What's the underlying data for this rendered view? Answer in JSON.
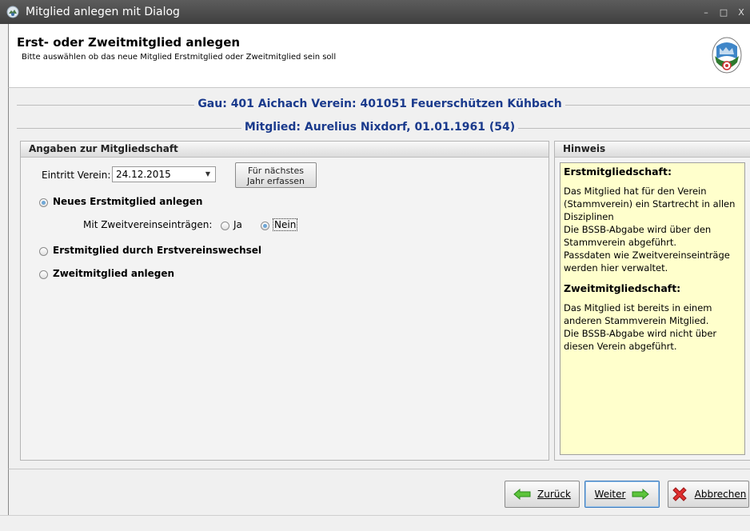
{
  "window": {
    "title": "Mitglied anlegen mit Dialog",
    "minimize": "–",
    "maximize": "□",
    "close": "X"
  },
  "header": {
    "title": "Erst- oder Zweitmitglied anlegen",
    "subtitle": "Bitte auswählen ob das neue Mitglied Erstmitglied oder Zweitmitglied sein soll"
  },
  "info": {
    "line1": "Gau: 401 Aichach   Verein: 401051 Feuerschützen Kühbach",
    "line2": "Mitglied: Aurelius Nixdorf, 01.01.1961 (54)"
  },
  "membership_panel": {
    "title": "Angaben zur Mitgliedschaft",
    "entry_label": "Eintritt Verein:",
    "entry_value": "24.12.2015",
    "next_year_button": [
      "Für nächstes",
      "Jahr erfassen"
    ],
    "options": [
      {
        "label": "Neues Erstmitglied anlegen",
        "checked": true
      },
      {
        "label": "Erstmitglied durch Erstvereinswechsel",
        "checked": false
      },
      {
        "label": "Zweitmitglied anlegen",
        "checked": false
      }
    ],
    "second_club_label": "Mit Zweitvereinseinträgen:",
    "second_club_yes": "Ja",
    "second_club_no": "Nein",
    "second_club_selected": "Nein"
  },
  "hint_panel": {
    "title": "Hinweis",
    "sections": [
      {
        "heading": "Erstmitgliedschaft:",
        "lines": [
          "Das Mitglied hat für den Verein",
          "(Stammverein) ein Startrecht in allen",
          "Disziplinen",
          "Die BSSB-Abgabe wird über den",
          "Stammverein abgeführt.",
          "Passdaten wie Zweitvereinseinträge",
          "werden hier verwaltet."
        ]
      },
      {
        "heading": "Zweitmitgliedschaft:",
        "lines": [
          "Das Mitglied ist bereits in einem",
          "anderen Stammverein Mitglied.",
          "Die BSSB-Abgabe wird nicht über",
          "diesen Verein abgeführt."
        ]
      }
    ]
  },
  "footer": {
    "back": "Zurück",
    "next": "Weiter",
    "cancel": "Abbrechen"
  },
  "colors": {
    "info_text": "#1a3a8c",
    "hint_bg": "#ffffcc",
    "arrow_green": "#4caf2a",
    "cancel_red": "#d8262b"
  }
}
